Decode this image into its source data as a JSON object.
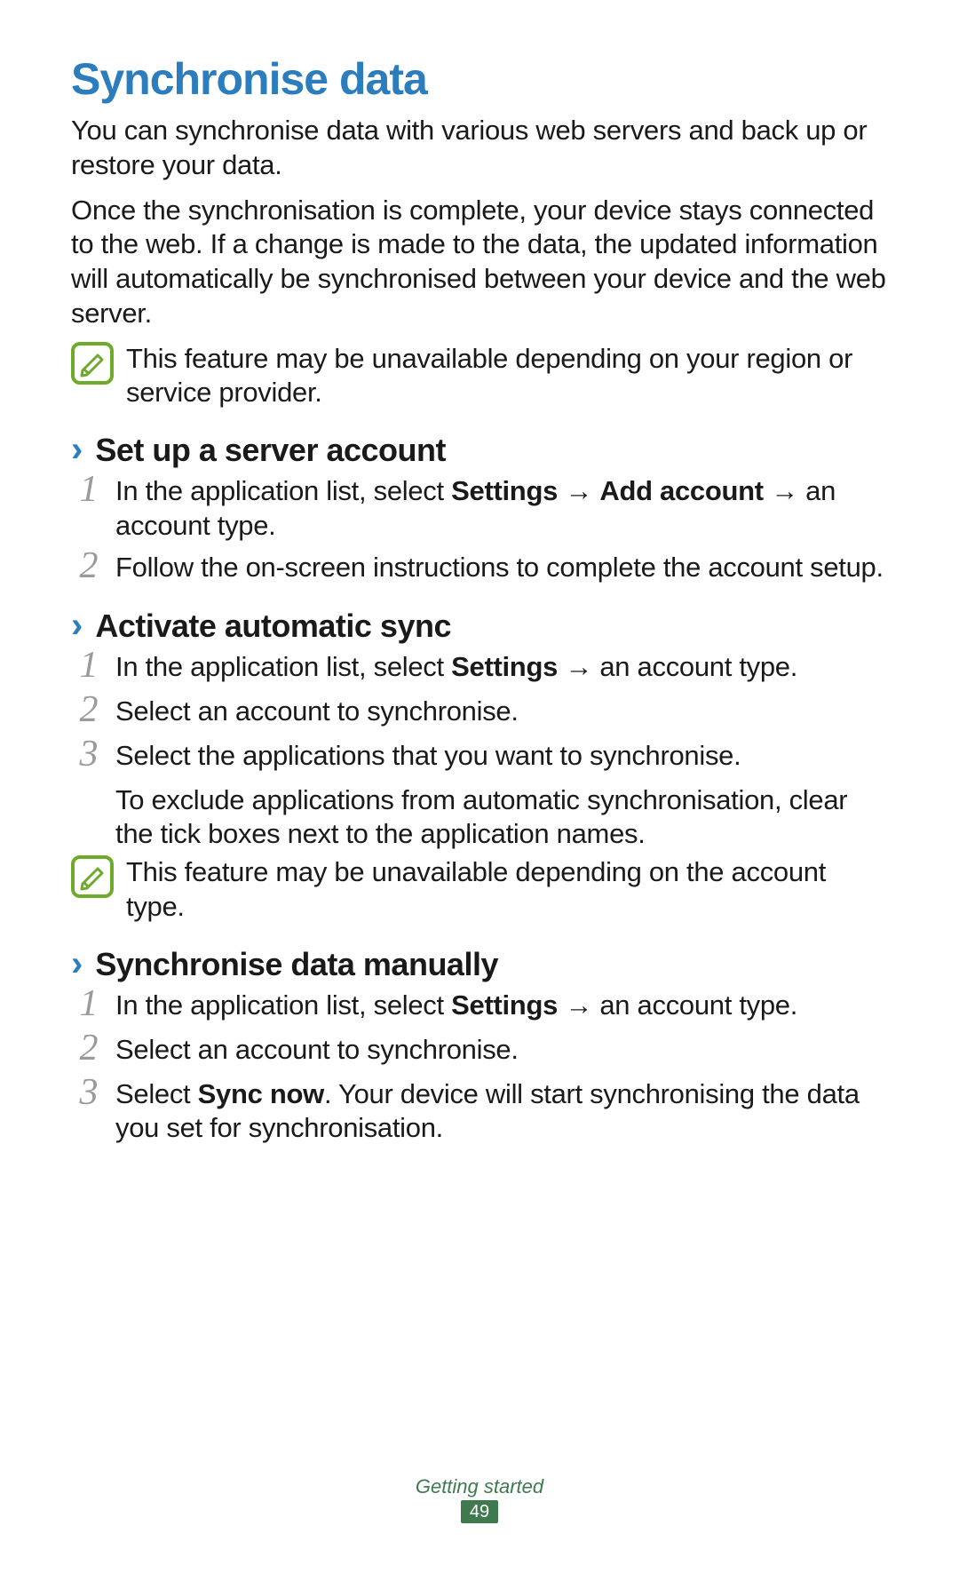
{
  "title": "Synchronise data",
  "intro1": "You can synchronise data with various web servers and back up or restore your data.",
  "intro2": "Once the synchronisation is complete, your device stays connected to the web. If a change is made to the data, the updated information will automatically be synchronised between your device and the web server.",
  "note1": "This feature may be unavailable depending on your region or service provider.",
  "chevron": "›",
  "arrow": "→",
  "sections": {
    "s1": {
      "title": "Set up a server account",
      "step1_pre": "In the application list, select ",
      "step1_b1": "Settings",
      "step1_mid1": " ",
      "step1_b2": "Add account",
      "step1_mid2": " ",
      "step1_post": " an account type.",
      "step2": "Follow the on-screen instructions to complete the account setup."
    },
    "s2": {
      "title": "Activate automatic sync",
      "step1_pre": "In the application list, select ",
      "step1_b1": "Settings",
      "step1_post": " an account type.",
      "step2": "Select an account to synchronise.",
      "step3": "Select the applications that you want to synchronise.",
      "step3_cont": "To exclude applications from automatic synchronisation, clear the tick boxes next to the application names.",
      "note": "This feature may be unavailable depending on the account type."
    },
    "s3": {
      "title": "Synchronise data manually",
      "step1_pre": "In the application list, select ",
      "step1_b1": "Settings",
      "step1_post": " an account type.",
      "step2": "Select an account to synchronise.",
      "step3_pre": "Select ",
      "step3_b1": "Sync now",
      "step3_post": ". Your device will start synchronising the data you set for synchronisation."
    }
  },
  "nums": {
    "n1": "1",
    "n2": "2",
    "n3": "3"
  },
  "footer": {
    "section": "Getting started",
    "page": "49"
  }
}
